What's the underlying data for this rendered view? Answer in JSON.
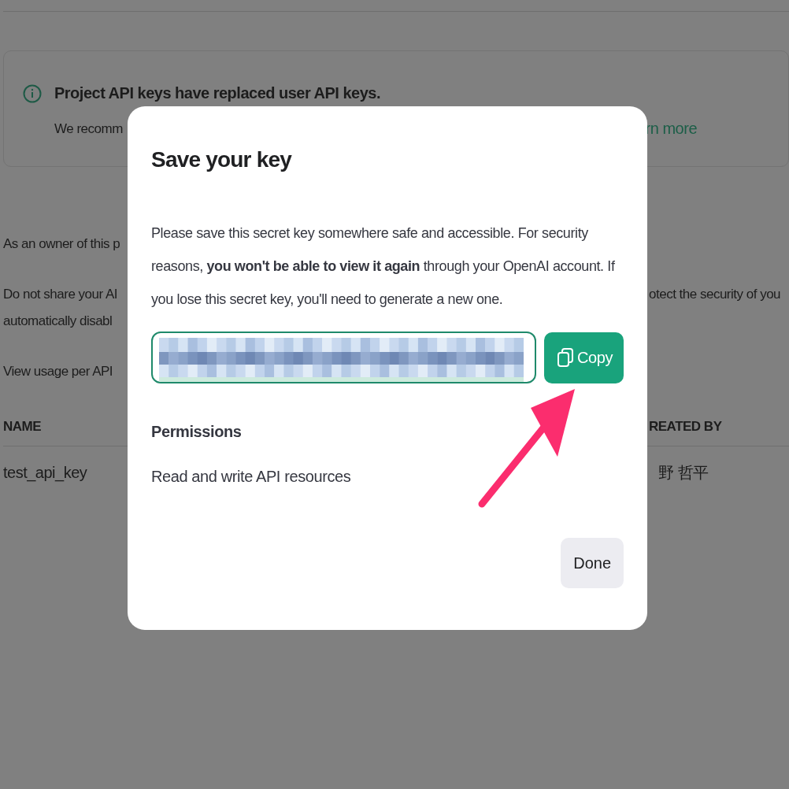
{
  "background_page": {
    "notice": {
      "title": "Project API keys have replaced user API keys.",
      "text_left": "We recomm",
      "link_right": "rn more"
    },
    "paragraphs": [
      {
        "left": "As an owner of this p"
      },
      {
        "left": "Do not share your AI",
        "right": "otect the security of you"
      },
      {
        "left": "automatically disabl"
      },
      {
        "left": "View usage per API"
      }
    ],
    "table": {
      "columns": [
        {
          "left": "NAME",
          "right": "REATED BY"
        }
      ],
      "rows": [
        {
          "name": "test_api_key",
          "created_by": "野 哲平"
        }
      ]
    }
  },
  "dialog": {
    "title": "Save your key",
    "message": "Please save this secret key somewhere safe and accessible. For security reasons, **you won't be able to view it again** through your OpenAI account. If you lose this secret key, you'll need to generate a new one.",
    "key_field": {
      "redacted": true
    },
    "copy_button": "Copy",
    "permissions_label": "Permissions",
    "permissions_value": "Read and write API resources",
    "done_button": "Done"
  }
}
